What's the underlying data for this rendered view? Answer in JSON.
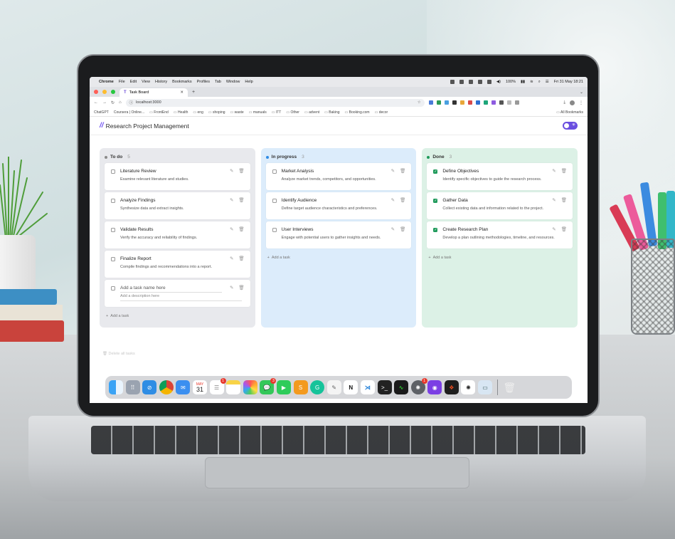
{
  "menubar": {
    "app": "Chrome",
    "items": [
      "File",
      "Edit",
      "View",
      "History",
      "Bookmarks",
      "Profiles",
      "Tab",
      "Window",
      "Help"
    ],
    "battery": "100%",
    "datetime": "Fri 31 May  18:21"
  },
  "browser": {
    "tab_title": "Task Board",
    "url": "localhost:3000",
    "bookmarks": [
      "ChatGPT",
      "Coursera | Online...",
      "FrontEnd",
      "Health",
      "eng",
      "shoping",
      "waste",
      "manuals",
      "ITT",
      "Other",
      "advent",
      "Baking",
      "Booking.com",
      "decor"
    ],
    "all_bookmarks": "All Bookmarks"
  },
  "app": {
    "logo": "//",
    "title": "Research Project Management",
    "theme_toggle_icon": "sun-icon"
  },
  "columns": [
    {
      "name": "To do",
      "count": "5",
      "dot_color": "#8a8a8a",
      "tasks": [
        {
          "title": "Literature Review",
          "desc": "Examine relevant literature and studies.",
          "done": false
        },
        {
          "title": "Analyze Findings",
          "desc": "Synthesize data and extract insights.",
          "done": false
        },
        {
          "title": "Validate Results",
          "desc": "Verify the accuracy and reliability of findings.",
          "done": false
        },
        {
          "title": "Finalize Report",
          "desc": "Compile findings and recommendations into a report.",
          "done": false
        }
      ],
      "new_task": {
        "name_placeholder": "Add a task name here",
        "desc_placeholder": "Add a description here"
      },
      "add_label": "Add a task"
    },
    {
      "name": "In progress",
      "count": "3",
      "dot_color": "#2f8be6",
      "tasks": [
        {
          "title": "Market Analysis",
          "desc": "Analyze market trends, competitors, and opportunities.",
          "done": false
        },
        {
          "title": "Identify Audience",
          "desc": "Define target audience characteristics and preferences.",
          "done": false
        },
        {
          "title": "User Interviews",
          "desc": "Engage with potential users to gather insights and needs.",
          "done": false
        }
      ],
      "add_label": "Add a task"
    },
    {
      "name": "Done",
      "count": "3",
      "dot_color": "#1f9a5b",
      "tasks": [
        {
          "title": "Define Objectives",
          "desc": "Identify specific objectives to guide the research process.",
          "done": true
        },
        {
          "title": "Gather Data",
          "desc": "Collect existing data and information related to the project.",
          "done": true
        },
        {
          "title": "Create Research Plan",
          "desc": "Develop a plan outlining methodologies, timeline, and resources.",
          "done": true
        }
      ],
      "add_label": "Add a task"
    }
  ],
  "footer": {
    "delete_all": "Delete all tasks"
  },
  "dock": {
    "calendar_month": "MAY",
    "calendar_day": "31",
    "reminders_badge": "1",
    "messages_badge": "3",
    "chatgpt_badge": "1",
    "apps": [
      "finder-icon",
      "launchpad-icon",
      "safari-icon",
      "chrome-icon",
      "mail-icon",
      "calendar-icon",
      "reminders-icon",
      "notes-icon",
      "photos-icon",
      "messages-icon",
      "facetime-icon",
      "sublime-icon",
      "grammarly-icon",
      "textedit-icon",
      "notion-icon",
      "vscode-icon",
      "terminal-icon",
      "activity-monitor-icon",
      "chatgpt-icon",
      "github-icon",
      "figma-icon",
      "openai-icon",
      "preview-icon",
      "trash-icon"
    ]
  },
  "colors": {
    "accent": "#6c4df0",
    "todo_bg": "#e8e9ed",
    "progress_bg": "#dcecfb",
    "done_bg": "#dcf1e6",
    "checked": "#1f9a5b"
  }
}
